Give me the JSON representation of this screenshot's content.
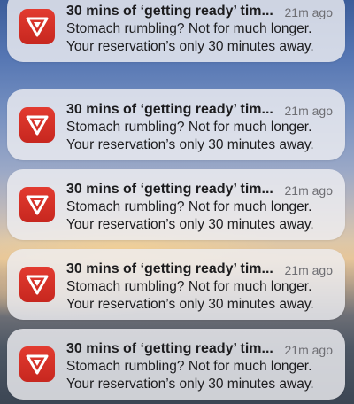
{
  "app": {
    "icon": "virgin-red-app-icon",
    "brand_color": "#D42E24"
  },
  "notifications": [
    {
      "title": "30 mins of ‘getting ready’ tim...",
      "time": "21m ago",
      "line1": "Stomach rumbling? Not for much longer.",
      "line2": "Your reservation’s only 30 minutes away."
    },
    {
      "title": "30 mins of ‘getting ready’ tim...",
      "time": "21m ago",
      "line1": "Stomach rumbling? Not for much longer.",
      "line2": "Your reservation’s only 30 minutes away."
    },
    {
      "title": "30 mins of ‘getting ready’ tim...",
      "time": "21m ago",
      "line1": "Stomach rumbling? Not for much longer.",
      "line2": "Your reservation’s only 30 minutes away."
    },
    {
      "title": "30 mins of ‘getting ready’ tim...",
      "time": "21m ago",
      "line1": "Stomach rumbling? Not for much longer.",
      "line2": "Your reservation’s only 30 minutes away."
    },
    {
      "title": "30 mins of ‘getting ready’ tim...",
      "time": "21m ago",
      "line1": "Stomach rumbling? Not for much longer.",
      "line2": "Your reservation’s only 30 minutes away."
    }
  ]
}
